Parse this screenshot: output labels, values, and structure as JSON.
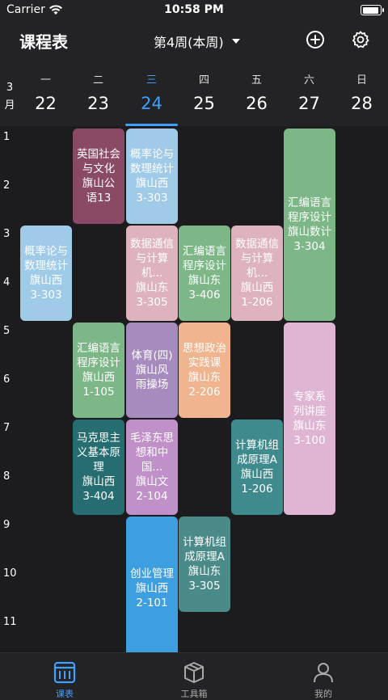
{
  "status": {
    "carrier": "Carrier",
    "time": "10:58 PM"
  },
  "nav": {
    "title": "课程表",
    "week": "第4周(本周)"
  },
  "header": {
    "month": "3\n月",
    "month_num": "3",
    "month_unit": "月",
    "days": [
      {
        "name": "一",
        "date": "22"
      },
      {
        "name": "二",
        "date": "23"
      },
      {
        "name": "三",
        "date": "24"
      },
      {
        "name": "四",
        "date": "25"
      },
      {
        "name": "五",
        "date": "26"
      },
      {
        "name": "六",
        "date": "27"
      },
      {
        "name": "日",
        "date": "28"
      }
    ]
  },
  "periods": [
    "1",
    "2",
    "3",
    "4",
    "5",
    "6",
    "7",
    "8",
    "9",
    "10",
    "11"
  ],
  "courses": [
    {
      "lines": [
        "英国社会",
        "与文化",
        "旗山公",
        "语13"
      ],
      "day": 1,
      "start": 1,
      "span": 2,
      "color": "#8a4a66"
    },
    {
      "lines": [
        "概率论与",
        "数理统计",
        "旗山西",
        "3-303"
      ],
      "day": 2,
      "start": 1,
      "span": 2,
      "color": "#9fcbe9"
    },
    {
      "lines": [
        "汇编语言",
        "程序设计",
        "旗山数计",
        "3-304"
      ],
      "day": 5,
      "start": 1,
      "span": 4,
      "color": "#7db788"
    },
    {
      "lines": [
        "概率论与",
        "数理统计",
        "旗山西",
        "3-303"
      ],
      "day": 0,
      "start": 3,
      "span": 2,
      "color": "#9fcbe9"
    },
    {
      "lines": [
        "数据通信",
        "与计算",
        "机...",
        "旗山东",
        "3-305"
      ],
      "day": 2,
      "start": 3,
      "span": 2,
      "color": "#deb3bd"
    },
    {
      "lines": [
        "汇编语言",
        "程序设计",
        "旗山东",
        "3-406"
      ],
      "day": 3,
      "start": 3,
      "span": 2,
      "color": "#7db788"
    },
    {
      "lines": [
        "数据通信",
        "与计算",
        "机...",
        "旗山西",
        "1-206"
      ],
      "day": 4,
      "start": 3,
      "span": 2,
      "color": "#deb3bd"
    },
    {
      "lines": [
        "汇编语言",
        "程序设计",
        "旗山西",
        "1-105"
      ],
      "day": 1,
      "start": 5,
      "span": 2,
      "color": "#7db788"
    },
    {
      "lines": [
        "体育(四)",
        "旗山风",
        "雨操场"
      ],
      "day": 2,
      "start": 5,
      "span": 2,
      "color": "#a78bbf"
    },
    {
      "lines": [
        "思想政治",
        "实践课",
        "旗山东",
        "2-206"
      ],
      "day": 3,
      "start": 5,
      "span": 2,
      "color": "#f0b48f"
    },
    {
      "lines": [
        "专家系",
        "列讲座",
        "旗山东",
        "3-100"
      ],
      "day": 5,
      "start": 5,
      "span": 4,
      "color": "#e0b5d4"
    },
    {
      "lines": [
        "马克思主",
        "义基本原",
        "理",
        "旗山西",
        "3-404"
      ],
      "day": 1,
      "start": 7,
      "span": 2,
      "color": "#256d70"
    },
    {
      "lines": [
        "毛泽东思",
        "想和中",
        "国...",
        "旗山文",
        "2-104"
      ],
      "day": 2,
      "start": 7,
      "span": 2,
      "color": "#c090c8"
    },
    {
      "lines": [
        "计算机组",
        "成原理A",
        "旗山西",
        "1-206"
      ],
      "day": 4,
      "start": 7,
      "span": 2,
      "color": "#3f8a8c"
    },
    {
      "lines": [
        "创业管理",
        "旗山西",
        "2-101"
      ],
      "day": 2,
      "start": 9,
      "span": 3,
      "color": "#3e9fe0"
    },
    {
      "lines": [
        "计算机组",
        "成原理A",
        "旗山东",
        "3-305"
      ],
      "day": 3,
      "start": 9,
      "span": 2,
      "color": "#4a8a88"
    }
  ],
  "tabs": [
    {
      "label": "课表",
      "icon": "calendar-icon",
      "active": true
    },
    {
      "label": "工具箱",
      "icon": "box-icon",
      "active": false
    },
    {
      "label": "我的",
      "icon": "profile-icon",
      "active": false
    }
  ]
}
